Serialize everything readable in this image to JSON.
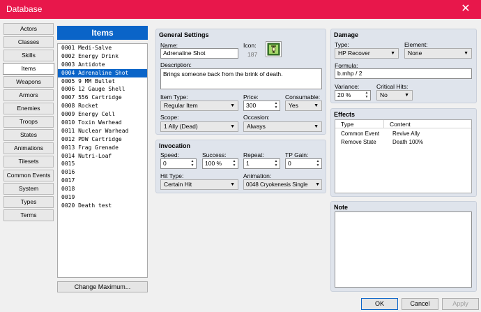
{
  "window": {
    "title": "Database"
  },
  "categories": [
    "Actors",
    "Classes",
    "Skills",
    "Items",
    "Weapons",
    "Armors",
    "Enemies",
    "Troops",
    "States",
    "Animations",
    "Tilesets",
    "Common Events",
    "System",
    "Types",
    "Terms"
  ],
  "selected_category": "Items",
  "items_panel": {
    "header": "Items",
    "list": [
      "0001 Medi-Salve",
      "0002 Energy Drink",
      "0003 Antidote",
      "0004 Adrenaline Shot",
      "0005 9 MM Bullet",
      "0006 12 Gauge Shell",
      "0007 556 Cartridge",
      "0008 Rocket",
      "0009 Energy Cell",
      "0010 Toxin Warhead",
      "0011 Nuclear Warhead",
      "0012 PDW Cartridge",
      "0013 Frag Grenade",
      "0014 Nutri-Loaf",
      "0015",
      "0016",
      "0017",
      "0018",
      "0019",
      "0020 Death test"
    ],
    "selected_index": 3,
    "change_max_label": "Change Maximum..."
  },
  "general": {
    "title": "General Settings",
    "name_label": "Name:",
    "name_value": "Adrenaline Shot",
    "icon_label": "Icon:",
    "icon_index": "187",
    "desc_label": "Description:",
    "desc_value": "Brings someone back from the brink of death.",
    "item_type_label": "Item Type:",
    "item_type_value": "Regular Item",
    "price_label": "Price:",
    "price_value": "300",
    "consumable_label": "Consumable:",
    "consumable_value": "Yes",
    "scope_label": "Scope:",
    "scope_value": "1 Ally (Dead)",
    "occasion_label": "Occasion:",
    "occasion_value": "Always"
  },
  "invocation": {
    "title": "Invocation",
    "speed_label": "Speed:",
    "speed_value": "0",
    "success_label": "Success:",
    "success_value": "100 %",
    "repeat_label": "Repeat:",
    "repeat_value": "1",
    "tp_label": "TP Gain:",
    "tp_value": "0",
    "hit_type_label": "Hit Type:",
    "hit_type_value": "Certain Hit",
    "animation_label": "Animation:",
    "animation_value": "0048 Cryokenesis Single"
  },
  "damage": {
    "title": "Damage",
    "type_label": "Type:",
    "type_value": "HP Recover",
    "element_label": "Element:",
    "element_value": "None",
    "formula_label": "Formula:",
    "formula_value": "b.mhp / 2",
    "variance_label": "Variance:",
    "variance_value": "20 %",
    "critical_label": "Critical Hits:",
    "critical_value": "No"
  },
  "effects": {
    "title": "Effects",
    "col_type": "Type",
    "col_content": "Content",
    "rows": [
      {
        "type": "Common Event",
        "content": "Revive Ally"
      },
      {
        "type": "Remove State",
        "content": "Death 100%"
      }
    ]
  },
  "note": {
    "title": "Note",
    "value": ""
  },
  "footer": {
    "ok": "OK",
    "cancel": "Cancel",
    "apply": "Apply"
  },
  "colors": {
    "titlebar": "#e8174b",
    "selection": "#0a64c8",
    "panel": "#dfe4ec"
  }
}
